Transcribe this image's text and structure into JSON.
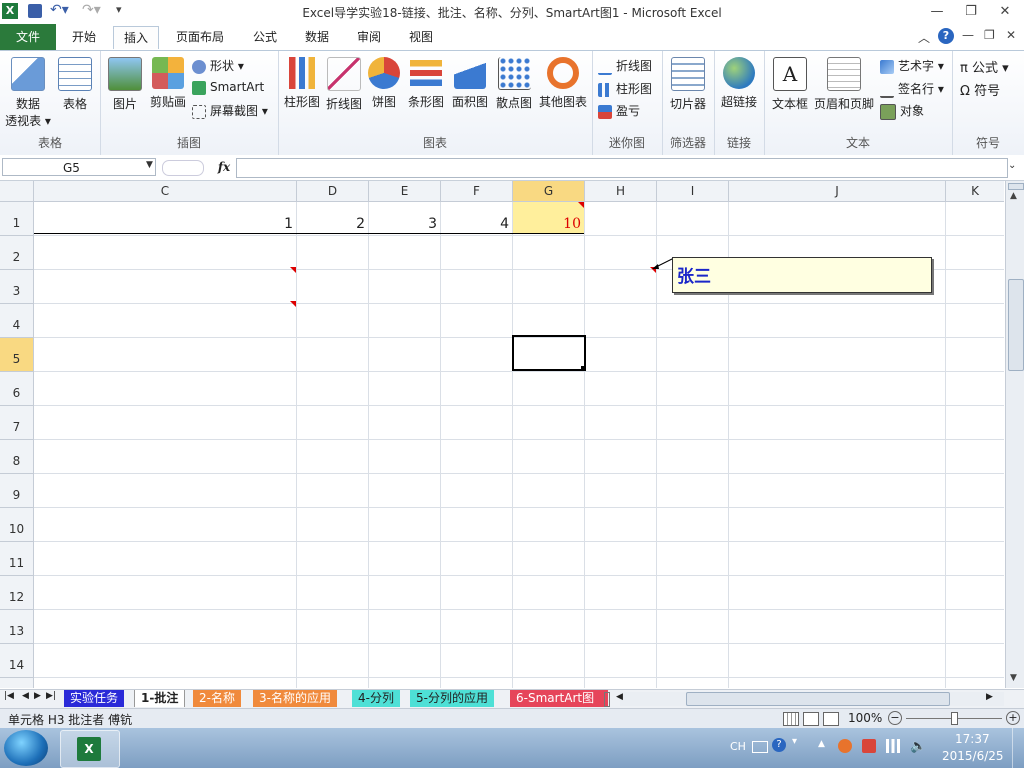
{
  "window": {
    "title": "Excel导学实验18-链接、批注、名称、分列、SmartArt图1  -  Microsoft Excel"
  },
  "ribbon_tabs": [
    "文件",
    "开始",
    "插入",
    "页面布局",
    "公式",
    "数据",
    "审阅",
    "视图"
  ],
  "ribbon": {
    "table_group": {
      "label": "表格",
      "pivot_line1": "数据",
      "pivot_line2": "透视表 ▾",
      "table": "表格"
    },
    "illustrations_group": {
      "label": "插图",
      "picture": "图片",
      "clipart": "剪贴画",
      "shapes": "形状 ▾",
      "smartart": "SmartArt",
      "screenshot": "屏幕截图 ▾"
    },
    "charts_group": {
      "label": "图表",
      "column": "柱形图",
      "line": "折线图",
      "pie": "饼图",
      "bar": "条形图",
      "area": "面积图",
      "scatter": "散点图",
      "other": "其他图表"
    },
    "sparklines_group": {
      "label": "迷你图",
      "line": "折线图",
      "column": "柱形图",
      "winloss": "盈亏"
    },
    "filter_group": {
      "label": "筛选器",
      "slicer": "切片器"
    },
    "links_group": {
      "label": "链接",
      "hyperlink": "超链接"
    },
    "text_group": {
      "label": "文本",
      "textbox": "文本框",
      "header_footer": "页眉和页脚",
      "wordart": "艺术字 ▾",
      "signature": "签名行 ▾",
      "object": "对象"
    },
    "symbols_group": {
      "label": "符号",
      "equation": "π 公式 ▾",
      "symbol": "Ω 符号"
    }
  },
  "formula_bar": {
    "name_box": "G5",
    "fx": "fx",
    "formula": ""
  },
  "columns": [
    "C",
    "D",
    "E",
    "F",
    "G",
    "H",
    "I",
    "J",
    "K"
  ],
  "rows": [
    "1",
    "2",
    "3",
    "4",
    "5",
    "6",
    "7",
    "8",
    "9",
    "10",
    "11",
    "12",
    "13",
    "14"
  ],
  "cells": {
    "C1": "1",
    "D1": "2",
    "E1": "3",
    "F1": "4",
    "G1": "10"
  },
  "comment": {
    "text": "张三"
  },
  "sheet_tabs": [
    "实验任务",
    "1-批注",
    "2-名称",
    "3-名称的应用",
    "4-分列",
    "5-分列的应用",
    "6-SmartArt图"
  ],
  "status": {
    "text": "单元格 H3 批注者 傅钪",
    "zoom": "100%"
  },
  "taskbar": {
    "time": "17:37",
    "date": "2015/6/25",
    "lang": "CH"
  }
}
